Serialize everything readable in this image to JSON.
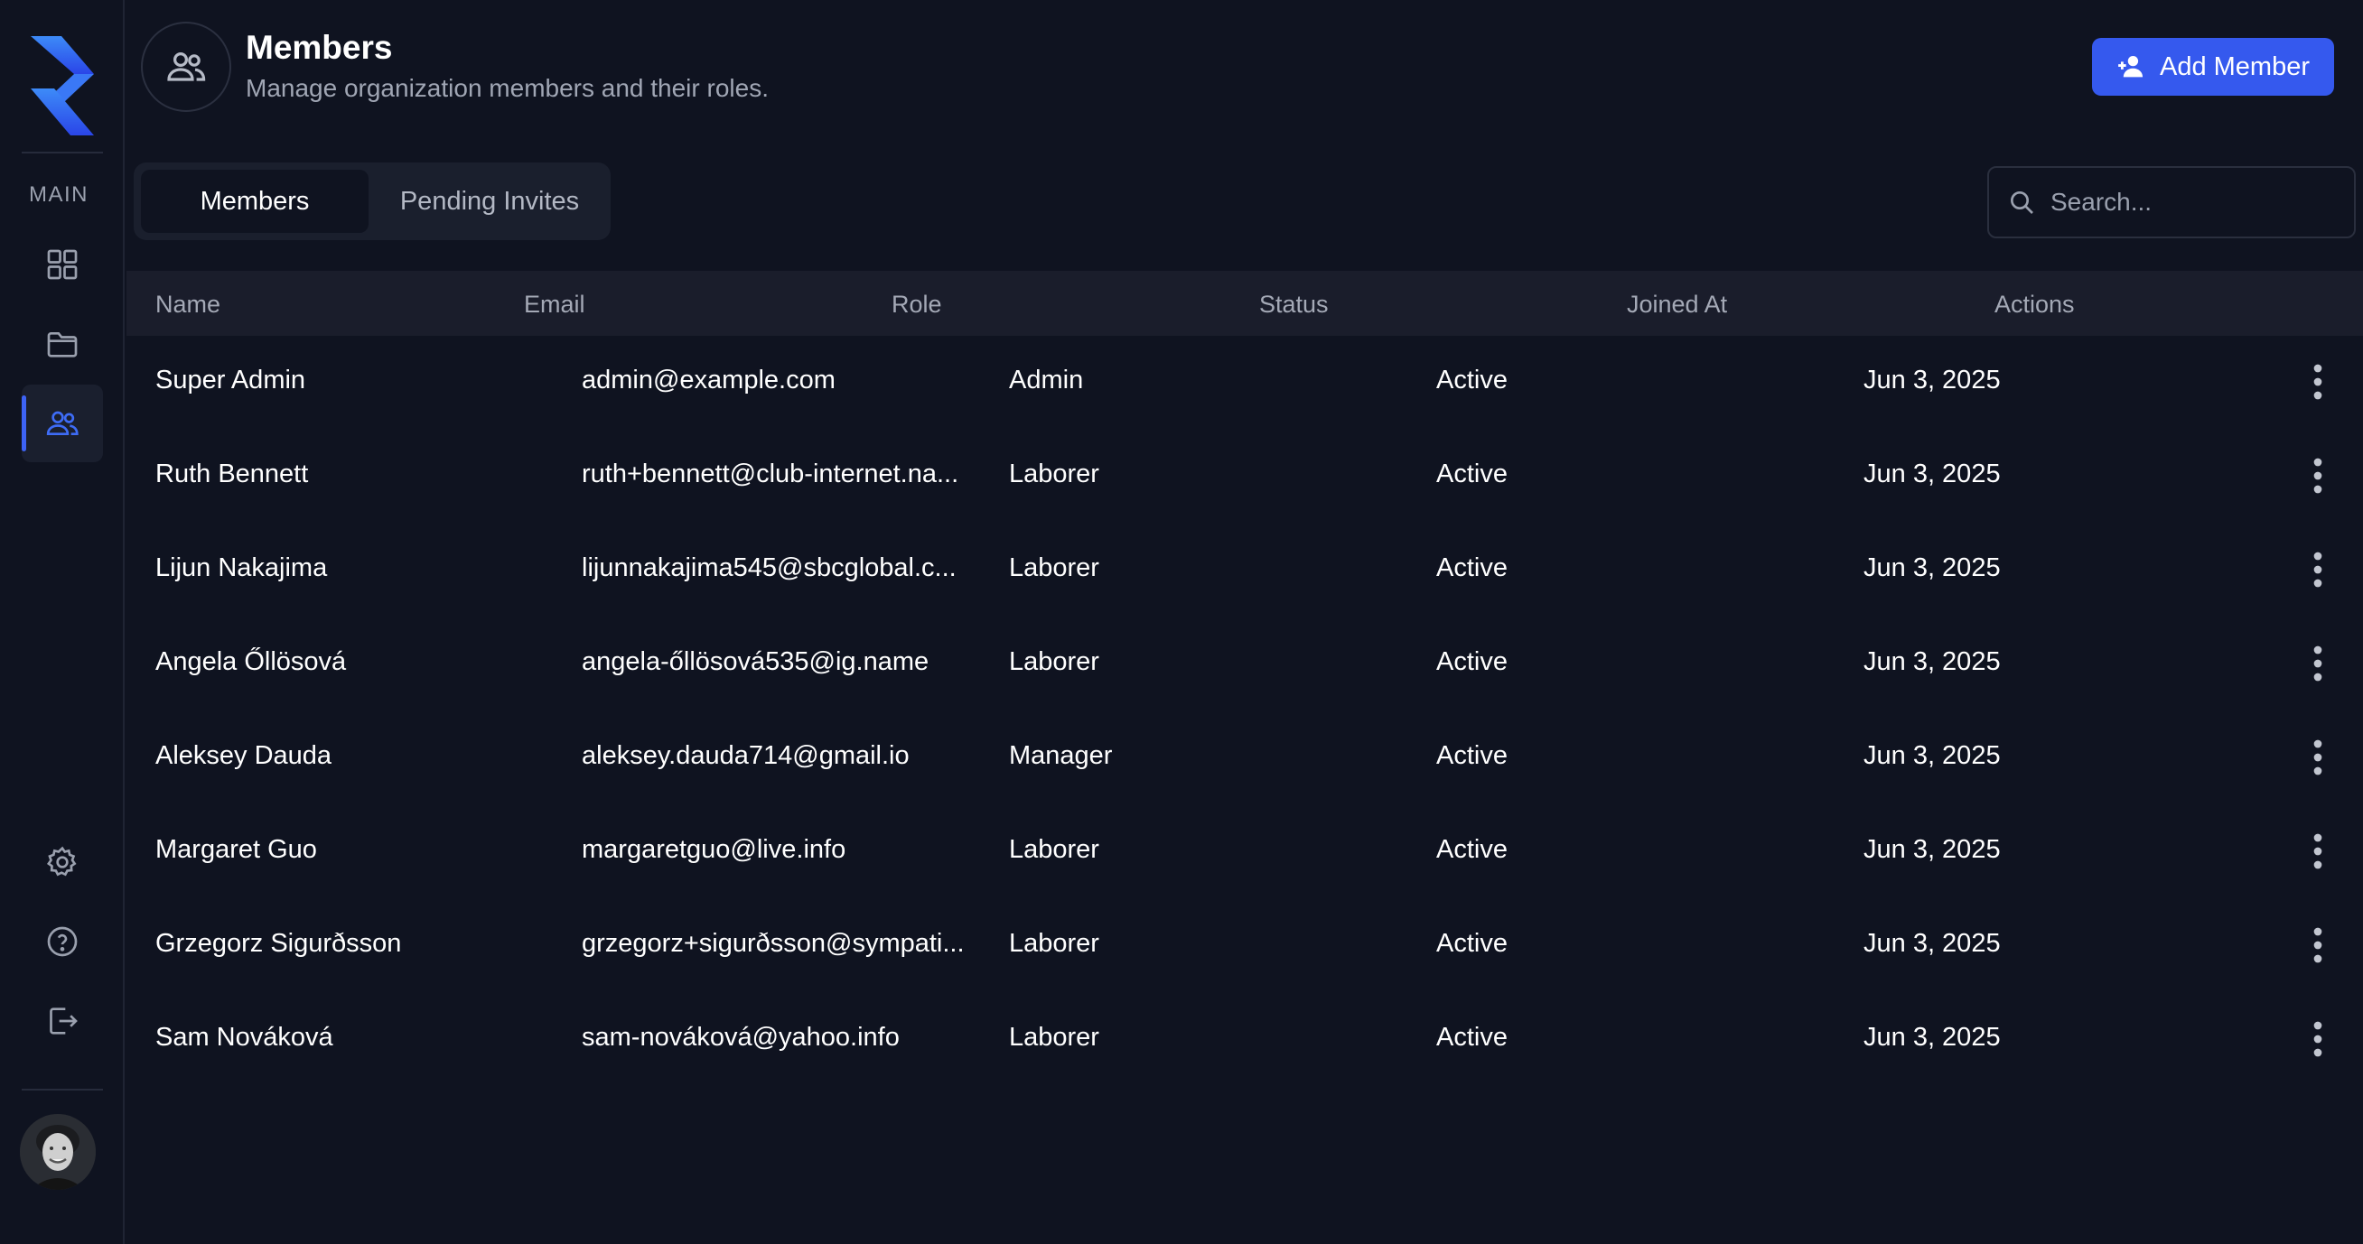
{
  "brand": {
    "accent": "#3559ee",
    "background": "#0f1320"
  },
  "sidebar": {
    "section_label": "MAIN",
    "items": [
      {
        "icon": "grid-icon",
        "active": false
      },
      {
        "icon": "folder-icon",
        "active": false
      },
      {
        "icon": "users-icon",
        "active": true
      }
    ],
    "bottom_items": [
      {
        "icon": "gear-icon"
      },
      {
        "icon": "help-circle-icon"
      },
      {
        "icon": "logout-icon"
      }
    ]
  },
  "header": {
    "title": "Members",
    "subtitle": "Manage organization members and their roles.",
    "add_button_label": "Add Member"
  },
  "tabs": [
    {
      "label": "Members",
      "active": true
    },
    {
      "label": "Pending Invites",
      "active": false
    }
  ],
  "search": {
    "placeholder": "Search...",
    "value": ""
  },
  "table": {
    "columns": [
      "Name",
      "Email",
      "Role",
      "Status",
      "Joined At",
      "Actions"
    ],
    "rows": [
      {
        "name": "Super Admin",
        "email": "admin@example.com",
        "role": "Admin",
        "status": "Active",
        "joined": "Jun 3, 2025"
      },
      {
        "name": "Ruth Bennett",
        "email": "ruth+bennett@club-internet.na...",
        "role": "Laborer",
        "status": "Active",
        "joined": "Jun 3, 2025"
      },
      {
        "name": "Lijun Nakajima",
        "email": "lijunnakajima545@sbcglobal.c...",
        "role": "Laborer",
        "status": "Active",
        "joined": "Jun 3, 2025"
      },
      {
        "name": "Angela Őllösová",
        "email": "angela-őllösová535@ig.name",
        "role": "Laborer",
        "status": "Active",
        "joined": "Jun 3, 2025"
      },
      {
        "name": "Aleksey Dauda",
        "email": "aleksey.dauda714@gmail.io",
        "role": "Manager",
        "status": "Active",
        "joined": "Jun 3, 2025"
      },
      {
        "name": "Margaret Guo",
        "email": "margaretguo@live.info",
        "role": "Laborer",
        "status": "Active",
        "joined": "Jun 3, 2025"
      },
      {
        "name": "Grzegorz Sigurðsson",
        "email": "grzegorz+sigurðsson@sympati...",
        "role": "Laborer",
        "status": "Active",
        "joined": "Jun 3, 2025"
      },
      {
        "name": "Sam Nováková",
        "email": "sam-nováková@yahoo.info",
        "role": "Laborer",
        "status": "Active",
        "joined": "Jun 3, 2025"
      }
    ]
  }
}
